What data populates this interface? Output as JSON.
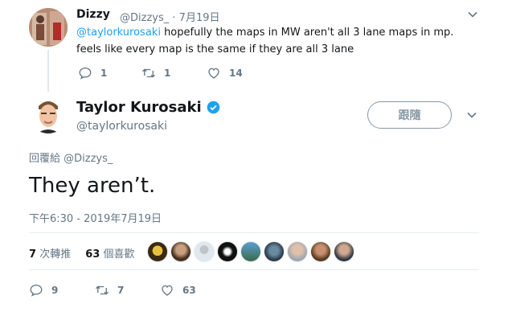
{
  "reply_tweet": {
    "name": "Dizzy",
    "handle": "@Dizzys_",
    "separator": "·",
    "date": "7月19日",
    "mention": "@taylorkurosaki",
    "text": " hopefully the maps in MW aren't all 3 lane maps in mp. feels like every map is the same if they are all 3 lane",
    "replies": "1",
    "retweets": "1",
    "likes": "14"
  },
  "main_tweet": {
    "name": "Taylor Kurosaki",
    "handle": "@taylorkurosaki",
    "follow_label": "跟隨",
    "replying_prefix": "回覆給",
    "replying_to": "@Dizzys_",
    "text": "They aren’t.",
    "timestamp": "下午6:30 - 2019年7月19日",
    "retweet_count": "7",
    "retweet_label": "次轉推",
    "like_count": "63",
    "like_label": "個喜歡",
    "replies": "9",
    "retweets": "7",
    "likes": "63"
  },
  "icons": {
    "reply": "reply-icon",
    "retweet": "retweet-icon",
    "like": "heart-icon",
    "verified": "verified-badge-icon",
    "more": "chevron-down-icon"
  },
  "colors": {
    "accent": "#1da1f2",
    "muted": "#657786",
    "text": "#14171a"
  }
}
